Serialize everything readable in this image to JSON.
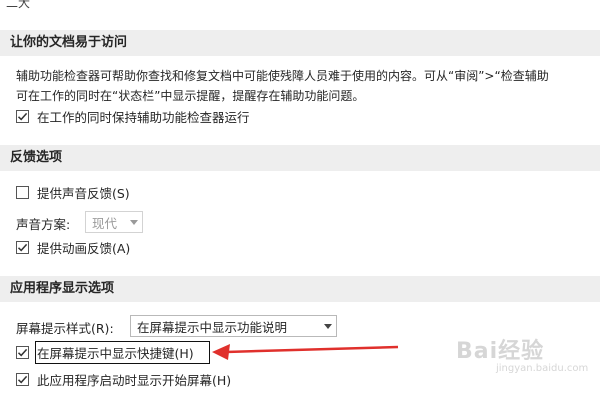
{
  "top_fragment": "二大",
  "accessibility": {
    "header": "让你的文档易于访问",
    "desc_line1": "辅助功能检查器可帮助你查找和修复文档中可能使残障人员难于使用的内容。可从“审阅”>“检查辅助",
    "desc_line2": "可在工作的同时在“状态栏”中显示提醒，提醒存在辅助功能问题。",
    "keep_checker_running": {
      "label": "在工作的同时保持辅助功能检查器运行",
      "checked": true
    }
  },
  "feedback": {
    "header": "反馈选项",
    "sound_feedback": {
      "label": "提供声音反馈(S)",
      "checked": false
    },
    "sound_scheme_label": "声音方案:",
    "sound_scheme_value": "现代",
    "animation_feedback": {
      "label": "提供动画反馈(A)",
      "checked": true
    }
  },
  "display": {
    "header": "应用程序显示选项",
    "screentip_style_label": "屏幕提示样式(R):",
    "screentip_style_value": "在屏幕提示中显示功能说明",
    "show_shortcuts": {
      "label": "在屏幕提示中显示快捷键(H)",
      "checked": true
    },
    "show_start_screen": {
      "label": "此应用程序启动时显示开始屏幕(H)",
      "checked": true
    }
  },
  "annotation": {
    "arrow_color": "#e0302c",
    "box_color": "#111111"
  },
  "watermark": {
    "text": "Bai经验",
    "sub": "jingyan.baidu.com"
  }
}
